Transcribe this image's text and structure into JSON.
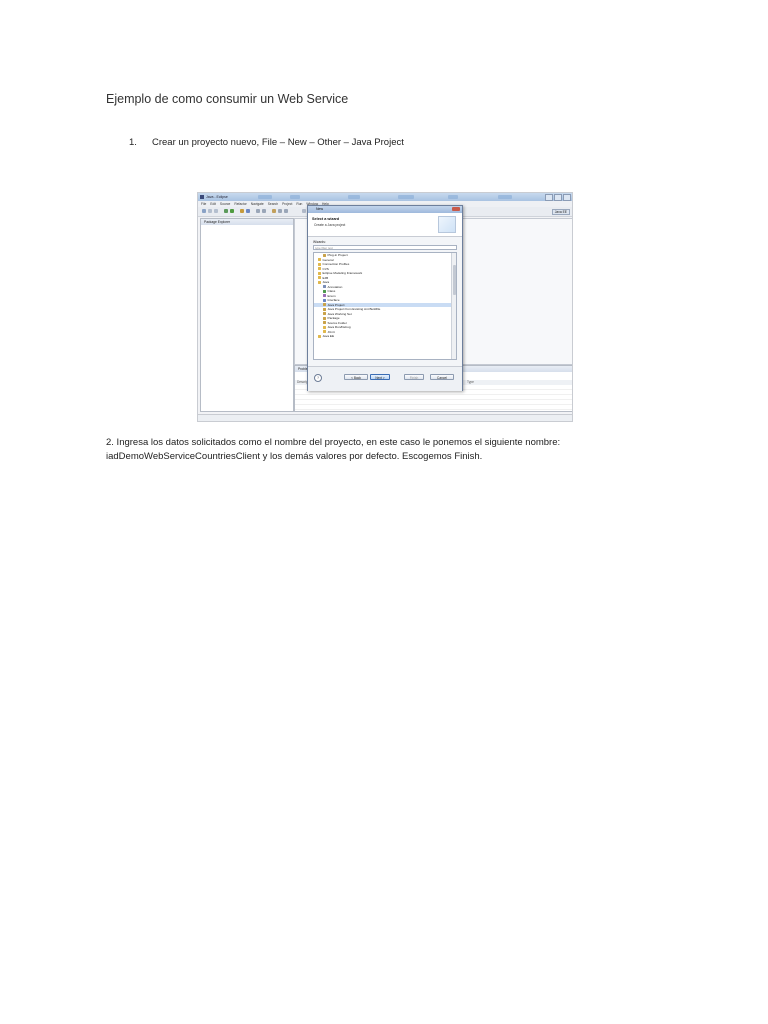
{
  "doc": {
    "title": "Ejemplo de como consumir un Web Service",
    "step1_number": "1.",
    "step1_text": "Crear un proyecto nuevo, File – New – Other – Java Project",
    "step2_line1": "2. Ingresa los datos solicitados como el nombre del proyecto, en este caso le ponemos el siguiente nombre:",
    "step2_line2": "iadDemoWebServiceCountriesClient y los demás valores por defecto. Escogemos Finish."
  },
  "screenshot": {
    "window_title": "Java - Eclipse",
    "menu": [
      "File",
      "Edit",
      "Source",
      "Refactor",
      "Navigate",
      "Search",
      "Project",
      "Run",
      "Window",
      "Help"
    ],
    "perspective_button": "Java EE",
    "package_explorer_title": "Package Explorer",
    "problems_title": "Problems",
    "problems_columns": [
      "Description",
      "Resource",
      "Path",
      "Location",
      "Type"
    ],
    "dialog": {
      "title": "New",
      "heading": "Select a wizard",
      "subheading": "Create a Java project",
      "wizards_label": "Wizards:",
      "filter_placeholder": "type filter text",
      "tree": [
        {
          "label": "Plug-in Project",
          "indent": 1,
          "color": "#c9a24a"
        },
        {
          "label": "General",
          "indent": 0,
          "color": "#e0b84c"
        },
        {
          "label": "Connection Profiles",
          "indent": 0,
          "color": "#e0b84c"
        },
        {
          "label": "CVS",
          "indent": 0,
          "color": "#e0b84c"
        },
        {
          "label": "Eclipse Modeling Framework",
          "indent": 0,
          "color": "#e0b84c"
        },
        {
          "label": "EJB",
          "indent": 0,
          "color": "#e0b84c"
        },
        {
          "label": "Java",
          "indent": 0,
          "color": "#e0b84c"
        },
        {
          "label": "Annotation",
          "indent": 1,
          "color": "#7a8db5"
        },
        {
          "label": "Class",
          "indent": 1,
          "color": "#4d9a4d"
        },
        {
          "label": "Enum",
          "indent": 1,
          "color": "#9b6bb5"
        },
        {
          "label": "Interface",
          "indent": 1,
          "color": "#6b86c2"
        },
        {
          "label": "Java Project",
          "indent": 1,
          "color": "#c9a24a",
          "selected": true
        },
        {
          "label": "Java Project from Existing Ant Buildfile",
          "indent": 1,
          "color": "#c9a24a"
        },
        {
          "label": "Java Working Set",
          "indent": 1,
          "color": "#c9a24a"
        },
        {
          "label": "Package",
          "indent": 1,
          "color": "#c9a24a"
        },
        {
          "label": "Source Folder",
          "indent": 1,
          "color": "#c9a24a"
        },
        {
          "label": "Java Run/Debug",
          "indent": 1,
          "color": "#e0b84c"
        },
        {
          "label": "JUnit",
          "indent": 1,
          "color": "#e0b84c"
        },
        {
          "label": "Java EE",
          "indent": 0,
          "color": "#e0b84c"
        }
      ],
      "buttons": {
        "help": "?",
        "back": "< Back",
        "next": "Next >",
        "finish": "Finish",
        "cancel": "Cancel"
      }
    }
  }
}
